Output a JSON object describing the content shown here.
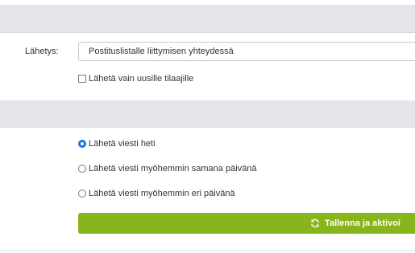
{
  "sending": {
    "label": "Lähetys:",
    "selected_option": "Postituslistalle liittymisen yhteydessä"
  },
  "new_subscribers_only": {
    "label": "Lähetä vain uusille tilaajille",
    "checked": false
  },
  "timing_options": [
    {
      "label": "Lähetä viesti heti",
      "checked": true
    },
    {
      "label": "Lähetä viesti myöhemmin samana päivänä",
      "checked": false
    },
    {
      "label": "Lähetä viesti myöhemmin eri päivänä",
      "checked": false
    }
  ],
  "save_button": {
    "label": "Tallenna ja aktivoi",
    "icon": "refresh-icon",
    "color": "#88b51c"
  }
}
